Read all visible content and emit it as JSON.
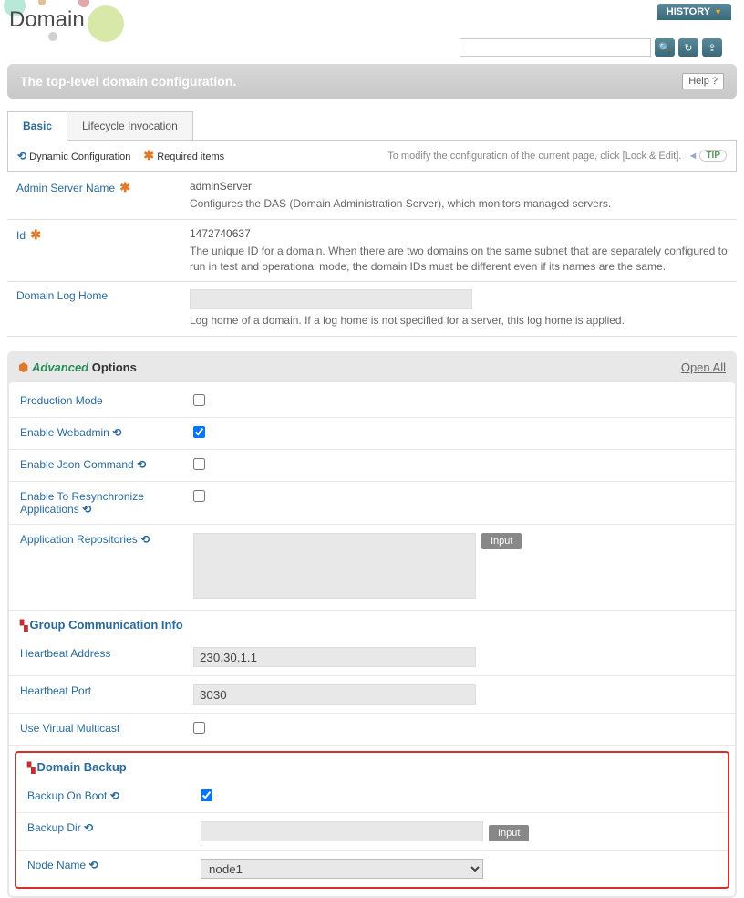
{
  "header": {
    "history_label": "HISTORY",
    "page_title": "Domain",
    "banner_title": "The top-level domain configuration.",
    "help_label": "Help  ?"
  },
  "tabs": {
    "basic": "Basic",
    "lifecycle": "Lifecycle Invocation"
  },
  "legend": {
    "dynamic": "Dynamic Configuration",
    "required": "Required items",
    "tip_msg": "To modify the configuration of the current page, click [Lock & Edit].",
    "tip_badge": "TIP"
  },
  "basic_fields": {
    "admin_server": {
      "label": "Admin Server Name",
      "value": "adminServer",
      "desc": "Configures the DAS (Domain Administration Server), which monitors managed servers."
    },
    "id": {
      "label": "Id",
      "value": "1472740637",
      "desc": "The unique ID for a domain. When there are two domains on the same subnet that are separately configured to run in test and operational mode, the domain IDs must be different even if its names are the same."
    },
    "log_home": {
      "label": "Domain Log Home",
      "value": "",
      "desc": "Log home of a domain. If a log home is not specified for a server, this log home is applied."
    }
  },
  "advanced": {
    "title_adv": "Advanced",
    "title_opt": "Options",
    "open_all": "Open All",
    "production_mode": {
      "label": "Production Mode",
      "checked": false
    },
    "enable_webadmin": {
      "label": "Enable Webadmin",
      "checked": true
    },
    "enable_json": {
      "label": "Enable Json Command",
      "checked": false
    },
    "enable_resync": {
      "label": "Enable To Resynchronize Applications",
      "checked": false
    },
    "app_repos": {
      "label": "Application Repositories",
      "input_btn": "Input"
    },
    "group_comm_header": "Group Communication Info",
    "heartbeat_address": {
      "label": "Heartbeat Address",
      "value": "230.30.1.1"
    },
    "heartbeat_port": {
      "label": "Heartbeat Port",
      "value": "3030"
    },
    "virtual_multicast": {
      "label": "Use Virtual Multicast",
      "checked": false
    },
    "domain_backup_header": "Domain Backup",
    "backup_on_boot": {
      "label": "Backup On Boot",
      "checked": true
    },
    "backup_dir": {
      "label": "Backup Dir",
      "value": "",
      "input_btn": "Input"
    },
    "node_name": {
      "label": "Node Name",
      "value": "node1"
    }
  }
}
